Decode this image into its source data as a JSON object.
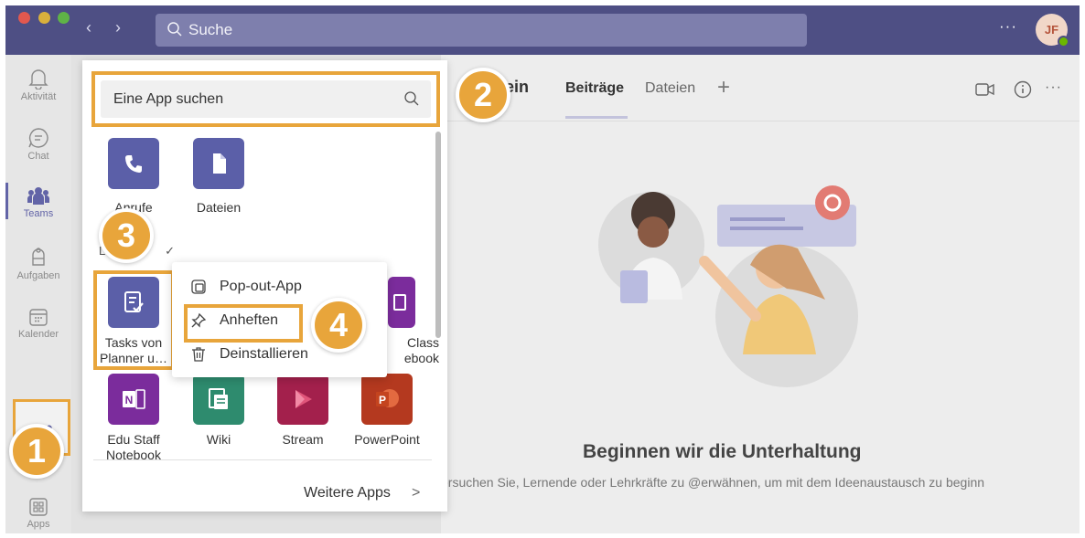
{
  "window": {
    "search_placeholder": "Suche",
    "more": "···",
    "avatar_initials": "JF"
  },
  "rail": {
    "items": [
      {
        "label": "Aktivität",
        "icon": "bell-icon"
      },
      {
        "label": "Chat",
        "icon": "chat-icon"
      },
      {
        "label": "Teams",
        "icon": "teams-icon"
      },
      {
        "label": "Aufgaben",
        "icon": "tasks-icon"
      },
      {
        "label": "Kalender",
        "icon": "calendar-icon"
      },
      {
        "label": "Apps",
        "icon": "apps-icon"
      }
    ],
    "more": "•••",
    "active": "Teams"
  },
  "flyout": {
    "search_placeholder": "Eine App suchen",
    "apps_top": [
      {
        "label": "Anrufe",
        "icon": "phone-icon",
        "color": "#5b5fa8"
      },
      {
        "label": "Dateien",
        "icon": "file-icon",
        "color": "#5b5fa8"
      }
    ],
    "section_label": "Le",
    "section_check": "✓",
    "tasks_app": {
      "label": "Tasks von Planner u…",
      "color": "#5b5fa8"
    },
    "hidden_app_label": "Class\nebook",
    "hidden_app_label_line1": "Class",
    "hidden_app_label_line2": "ebook",
    "apps_bottom": [
      {
        "label": "Edu Staff Notebook",
        "icon": "onenote-icon",
        "color": "#7b2c9c"
      },
      {
        "label": "Wiki",
        "icon": "wiki-icon",
        "color": "#2e8b6e"
      },
      {
        "label": "Stream",
        "icon": "stream-icon",
        "color": "#a3204c"
      },
      {
        "label": "PowerPoint",
        "icon": "powerpoint-icon",
        "color": "#b4391f"
      }
    ],
    "more_apps": "Weitere Apps",
    "more_apps_chevron": ">"
  },
  "context_menu": {
    "items": [
      {
        "label": "Pop-out-App",
        "icon": "popout-icon"
      },
      {
        "label": "Anheften",
        "icon": "pin-icon"
      },
      {
        "label": "Deinstallieren",
        "icon": "trash-icon"
      }
    ]
  },
  "channel": {
    "title_fragment": "mein",
    "tabs": [
      "Beiträge",
      "Dateien"
    ],
    "active_tab": "Beiträge",
    "add_tab": "+",
    "header_more": "···",
    "empty_title": "Beginnen wir die Unterhaltung",
    "empty_subtitle": "ersuchen Sie, Lernende oder Lehrkräfte zu @erwähnen, um mit dem Ideenaustausch zu beginn"
  },
  "callouts": [
    "1",
    "2",
    "3",
    "4"
  ],
  "colors": {
    "titlebar": "#4e4f84",
    "accent": "#6264a7",
    "callout": "#e8a53b"
  }
}
